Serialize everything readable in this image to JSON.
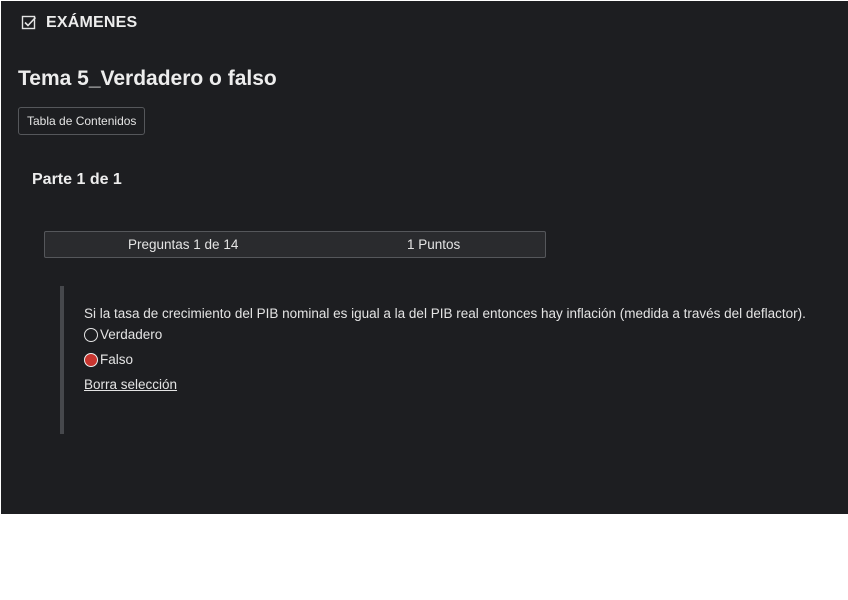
{
  "header": {
    "icon": "checkbox-icon",
    "title": "EXÁMENES"
  },
  "exam": {
    "title": "Tema 5_Verdadero o falso",
    "toc_button": "Tabla de Contenidos",
    "part": "Parte 1 de 1"
  },
  "question_bar": {
    "count": "Preguntas 1 de 14",
    "points": "1 Puntos"
  },
  "question": {
    "text": "Si la tasa de crecimiento del PIB nominal es igual a la del PIB real entonces hay inflación (medida a través del deflactor).",
    "options": [
      {
        "label": "Verdadero",
        "selected": false
      },
      {
        "label": "Falso",
        "selected": true
      }
    ],
    "clear_selection": "Borra selección"
  },
  "colors": {
    "background": "#1d1e21",
    "selected_radio": "#c8352f",
    "text": "#e4e4e4"
  }
}
